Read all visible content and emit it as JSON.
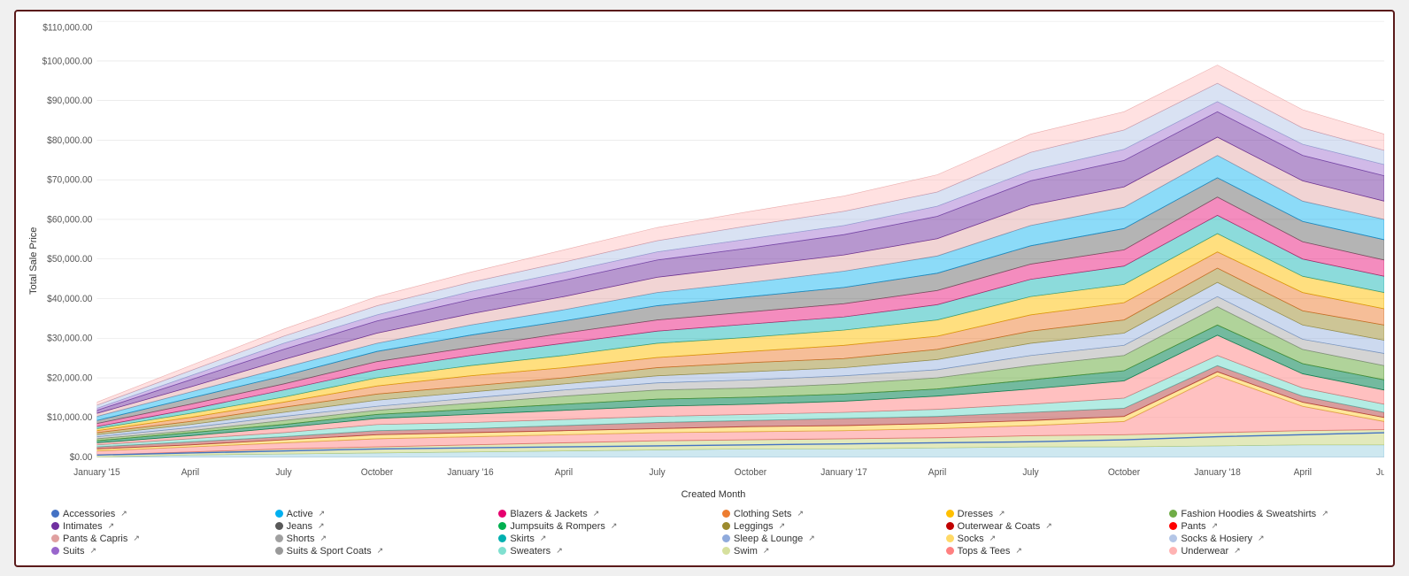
{
  "chart": {
    "title": "",
    "yAxisLabel": "Total Sale Price",
    "xAxisLabel": "Created Month",
    "yTicks": [
      "$0.00",
      "$10,000.00",
      "$20,000.00",
      "$30,000.00",
      "$40,000.00",
      "$50,000.00",
      "$60,000.00",
      "$70,000.00",
      "$80,000.00",
      "$90,000.00",
      "$100,000.00",
      "$110,000.00"
    ],
    "xTicks": [
      "January '15",
      "April",
      "July",
      "October",
      "January '16",
      "April",
      "July",
      "October",
      "January '17",
      "April",
      "July",
      "October",
      "January '18",
      "April",
      "July"
    ]
  },
  "legend": {
    "items": [
      {
        "label": "Accessories",
        "color": "#4472c4"
      },
      {
        "label": "Active",
        "color": "#00b0f0"
      },
      {
        "label": "Blazers & Jackets",
        "color": "#e6006e"
      },
      {
        "label": "Clothing Sets",
        "color": "#ed7d31"
      },
      {
        "label": "Dresses",
        "color": "#ffc000"
      },
      {
        "label": "Fashion Hoodies & Sweatshirts",
        "color": "#70ad47"
      },
      {
        "label": "Intimates",
        "color": "#7030a0"
      },
      {
        "label": "Jeans",
        "color": "#595959"
      },
      {
        "label": "Jumpsuits & Rompers",
        "color": "#00b050"
      },
      {
        "label": "Leggings",
        "color": "#9c8b2e"
      },
      {
        "label": "Outerwear & Coats",
        "color": "#c00000"
      },
      {
        "label": "Pants",
        "color": "#ff0000"
      },
      {
        "label": "Pants & Capris",
        "color": "#e0a0a0"
      },
      {
        "label": "Skirts",
        "color": "#00b0b0"
      },
      {
        "label": "Sleep & Lounge",
        "color": "#8faadc"
      },
      {
        "label": "Socks",
        "color": "#ffd966"
      },
      {
        "label": "Socks & Hosiery",
        "color": "#b4c6e7"
      },
      {
        "label": "Suits",
        "color": "#9966cc"
      },
      {
        "label": "Suits & Sport Coats",
        "color": "#999999"
      },
      {
        "label": "Sweaters",
        "color": "#80e0d0"
      },
      {
        "label": "Swim",
        "color": "#d6e09e"
      },
      {
        "label": "Tops & Tees",
        "color": "#ff8080"
      },
      {
        "label": "Underwear",
        "color": "#ffb3b3"
      }
    ]
  }
}
